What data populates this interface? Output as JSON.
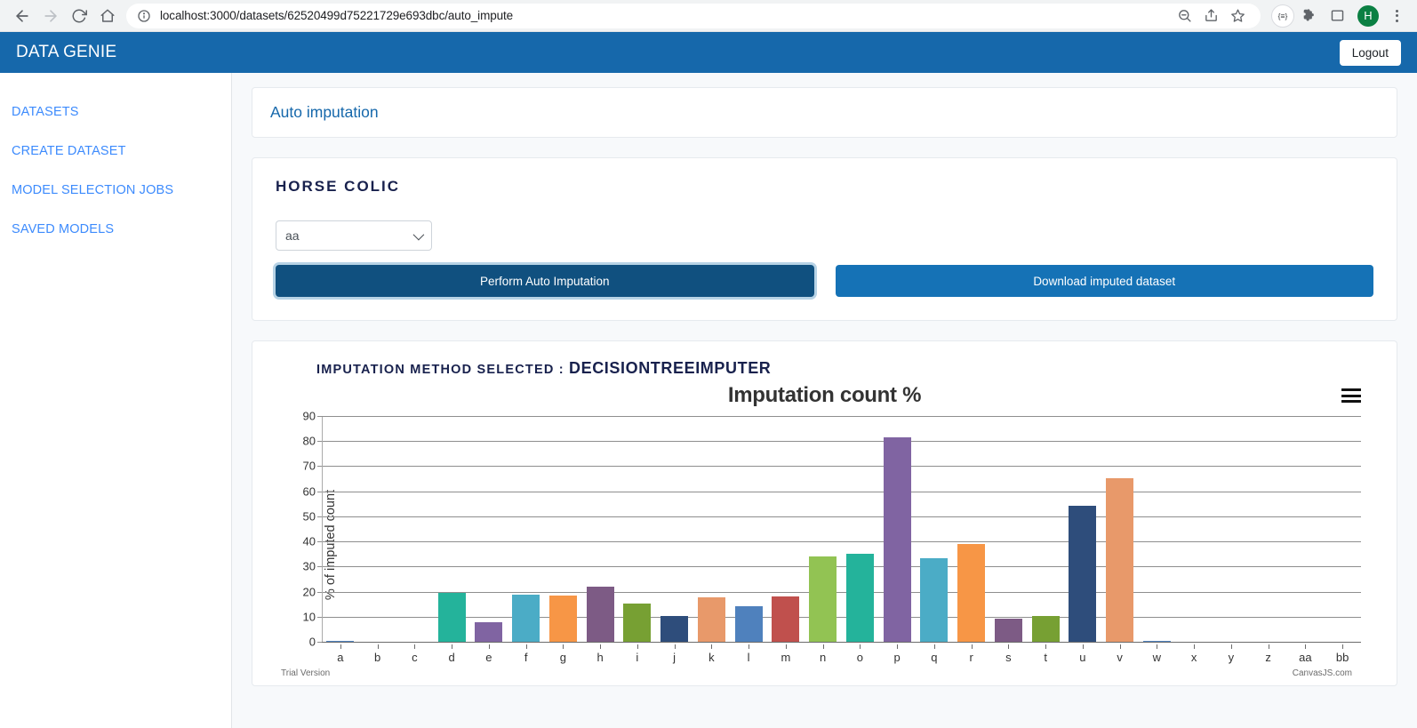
{
  "browser": {
    "url": "localhost:3000/datasets/62520499d75221729e693dbc/auto_impute",
    "back_icon": "back-arrow-icon",
    "forward_icon": "forward-arrow-icon",
    "reload_icon": "reload-icon",
    "home_icon": "home-icon",
    "info_icon": "site-info-icon",
    "zoom_icon": "zoom-out-icon",
    "share_icon": "share-icon",
    "bookmark_icon": "bookmark-star-icon",
    "media_badge_label": "{≡}",
    "extensions_icon": "puzzle-piece-icon",
    "sidepanel_icon": "side-panel-icon",
    "profile_initial": "H",
    "menu_icon": "kebab-menu-icon"
  },
  "app": {
    "brand": "DATA GENIE",
    "logout_label": "Logout",
    "header_bg": "#1668ab"
  },
  "sidebar": {
    "items": [
      {
        "label": "DATASETS"
      },
      {
        "label": "CREATE DATASET"
      },
      {
        "label": "MODEL SELECTION JOBS"
      },
      {
        "label": "SAVED MODELS"
      }
    ],
    "link_color": "#3d8bfd"
  },
  "main": {
    "page_title": "Auto imputation",
    "dataset_name": "HORSE COLIC",
    "column_select": {
      "value": "aa",
      "chevron_icon": "chevron-down-icon"
    },
    "perform_button": "Perform Auto Imputation",
    "download_button": "Download imputed dataset",
    "method_prefix": "IMPUTATION METHOD SELECTED :",
    "method_name": "DECISIONTREEIMPUTER",
    "menu_icon": "hamburger-menu-icon",
    "trial_notice": "Trial Version",
    "watermark": "CanvasJS.com"
  },
  "chart_data": {
    "type": "bar",
    "title": "Imputation count %",
    "xlabel": "",
    "ylabel": "% of imputed count",
    "ylim": [
      0,
      90
    ],
    "yticks": [
      0,
      10,
      20,
      30,
      40,
      50,
      60,
      70,
      80,
      90
    ],
    "grid": true,
    "legend": "none",
    "categories": [
      "a",
      "b",
      "c",
      "d",
      "e",
      "f",
      "g",
      "h",
      "i",
      "j",
      "k",
      "l",
      "m",
      "n",
      "o",
      "p",
      "q",
      "r",
      "s",
      "t",
      "u",
      "v",
      "w",
      "x",
      "y",
      "z",
      "aa",
      "bb"
    ],
    "values": [
      0.4,
      0,
      0,
      19.8,
      8.1,
      19.1,
      18.7,
      22.5,
      15.5,
      10.6,
      18.2,
      14.5,
      18.6,
      34.5,
      35.3,
      82.0,
      33.8,
      39.5,
      9.6,
      10.8,
      54.6,
      65.6,
      0.4,
      0,
      0,
      0,
      0,
      0
    ],
    "colors": [
      "#4f81bd",
      "#4f81bd",
      "#4f81bd",
      "#24b39b",
      "#8064a2",
      "#4bacc6",
      "#f79646",
      "#7d5b85",
      "#77a033",
      "#2e4d7b",
      "#e8996a",
      "#4f81bd",
      "#c0504d",
      "#92c353",
      "#24b39b",
      "#8064a2",
      "#4bacc6",
      "#f79646",
      "#7d5b85",
      "#77a033",
      "#2e4d7b",
      "#e8996a",
      "#4f81bd",
      "#c0504d",
      "#92c353",
      "#24b39b",
      "#8064a2",
      "#4bacc6"
    ]
  }
}
